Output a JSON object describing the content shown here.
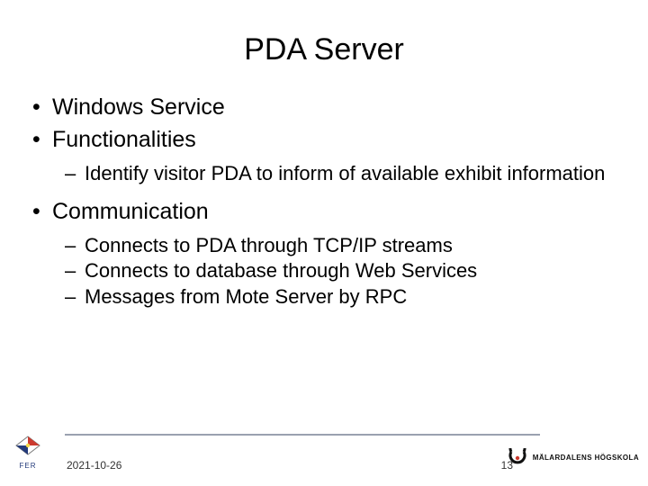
{
  "title": "PDA Server",
  "bullets": {
    "b0": {
      "text": "Windows Service"
    },
    "b1": {
      "text": "Functionalities"
    },
    "b1_sub": {
      "s0": "Identify visitor PDA to inform of available exhibit information"
    },
    "b2": {
      "text": "Communication"
    },
    "b2_sub": {
      "s0": "Connects to PDA through TCP/IP streams",
      "s1": "Connects to database through Web Services",
      "s2": "Messages from Mote Server by RPC"
    }
  },
  "footer": {
    "date": "2021-10-26",
    "page": "13",
    "left_logo_label": "FER",
    "right_logo_label": "MÄLARDALENS HÖGSKOLA"
  }
}
